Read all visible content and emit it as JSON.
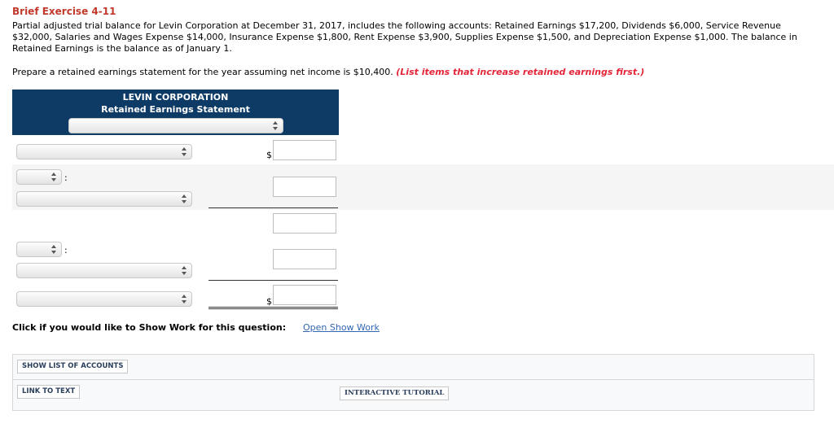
{
  "exercise": {
    "title": "Brief Exercise 4-11",
    "description": "Partial adjusted trial balance for Levin Corporation at December 31, 2017, includes the following accounts: Retained Earnings $17,200, Dividends $6,000, Service Revenue $32,000, Salaries and Wages Expense $14,000, Insurance Expense $1,800, Rent Expense $3,900, Supplies Expense $1,500, and Depreciation Expense $1,000. The balance in Retained Earnings is the balance as of January 1.",
    "prompt": "Prepare a retained earnings statement for the year assuming net income is $10,400.",
    "hint": "(List items that increase retained earnings first.)"
  },
  "statement": {
    "company": "LEVIN CORPORATION",
    "name": "Retained Earnings Statement",
    "period_select": "",
    "rows": [
      {
        "select": "",
        "currency": "$",
        "amount": ""
      },
      {
        "select": "",
        "amount": ""
      },
      {
        "amount": ""
      },
      {
        "select": "",
        "amount": ""
      },
      {
        "select": "",
        "currency": "$",
        "amount": ""
      }
    ],
    "short_selects": [
      "",
      ""
    ],
    "colon": ":"
  },
  "show_work": {
    "label": "Click if you would like to Show Work for this question:",
    "link": "Open Show Work"
  },
  "buttons": {
    "list_accounts": "SHOW LIST OF ACCOUNTS",
    "link_to_text": "LINK TO TEXT",
    "tutorial": "INTERACTIVE TUTORIAL"
  },
  "colors": {
    "title": "#c0392b",
    "hint": "#e3263a",
    "header_bg": "#0d3b66",
    "link": "#3366b3"
  }
}
